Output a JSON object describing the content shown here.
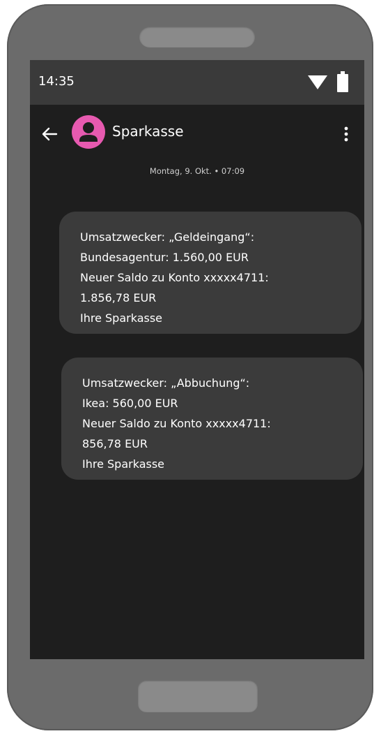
{
  "status_bar": {
    "time": "14:35",
    "icons": [
      "wifi-icon",
      "battery-icon"
    ]
  },
  "app_bar": {
    "back_icon": "arrow-left-icon",
    "avatar_icon": "person-icon",
    "contact_name": "Sparkasse",
    "menu_icon": "more-vertical-icon"
  },
  "conversation": {
    "date_divider": "Montag, 9. Okt. • 07:09",
    "messages": [
      {
        "lines": [
          "Umsatzwecker: „Geldeingang“:",
          "Bundesagentur: 1.560,00 EUR",
          "Neuer Saldo zu Konto xxxxx4711:",
          "1.856,78 EUR",
          "Ihre Sparkasse"
        ]
      },
      {
        "lines": [
          "Umsatzwecker: „Abbuchung“:",
          "Ikea: 560,00 EUR",
          "Neuer Saldo zu Konto xxxxx4711:",
          "856,78 EUR",
          "Ihre Sparkasse"
        ]
      }
    ]
  },
  "colors": {
    "phone_body": "#6b6b6b",
    "status_bar": "#3a3a3a",
    "screen_background": "#1e1e1e",
    "bubble": "#3b3b3b",
    "avatar": "#e75ab0"
  }
}
